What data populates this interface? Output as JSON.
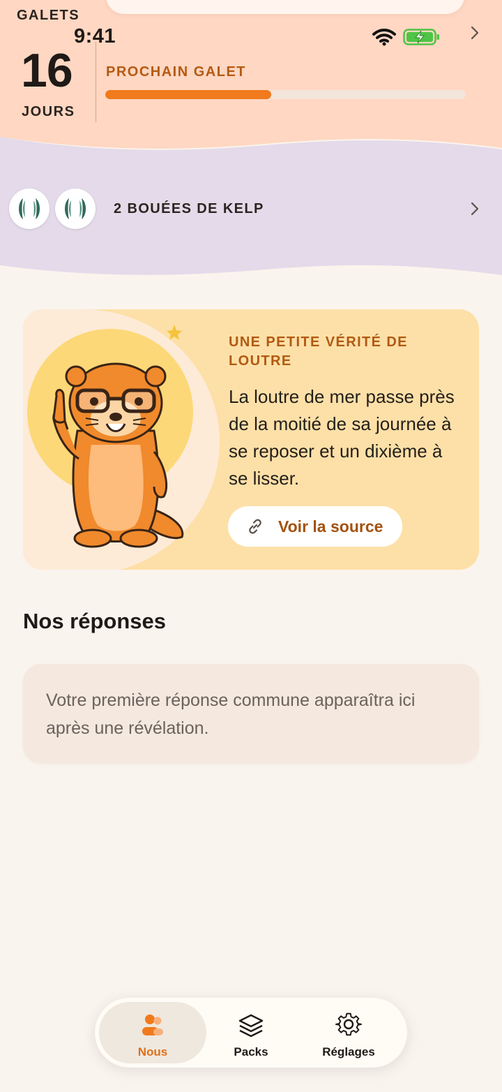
{
  "status_bar": {
    "time": "9:41"
  },
  "streak": {
    "label": "GALETS",
    "count": "16",
    "unit": "JOURS",
    "next_label": "PROCHAIN GALET",
    "next_progress_percent": 46
  },
  "kelp": {
    "label": "2 BOUÉES DE KELP",
    "badge_count": 2
  },
  "fact": {
    "kicker": "UNE PETITE VÉRITÉ DE LOUTRE",
    "body": "La loutre de mer passe près de la moitié de sa journée à se reposer et un dixième à se lisser.",
    "source_label": "Voir la source",
    "mascot_icon": "otter-with-glasses-icon"
  },
  "answers": {
    "title": "Nos réponses",
    "empty_text": "Votre première réponse commune apparaîtra ici après une révélation."
  },
  "tabs": [
    {
      "label": "Nous",
      "icon": "people-icon",
      "active": true
    },
    {
      "label": "Packs",
      "icon": "layers-icon",
      "active": false
    },
    {
      "label": "Réglages",
      "icon": "gear-icon",
      "active": false
    }
  ],
  "colors": {
    "accent": "#f07a1c",
    "top_band": "#ffd7c2",
    "kelp_band": "#e4dae9",
    "card": "#fde0a8",
    "background": "#faf4ee"
  }
}
